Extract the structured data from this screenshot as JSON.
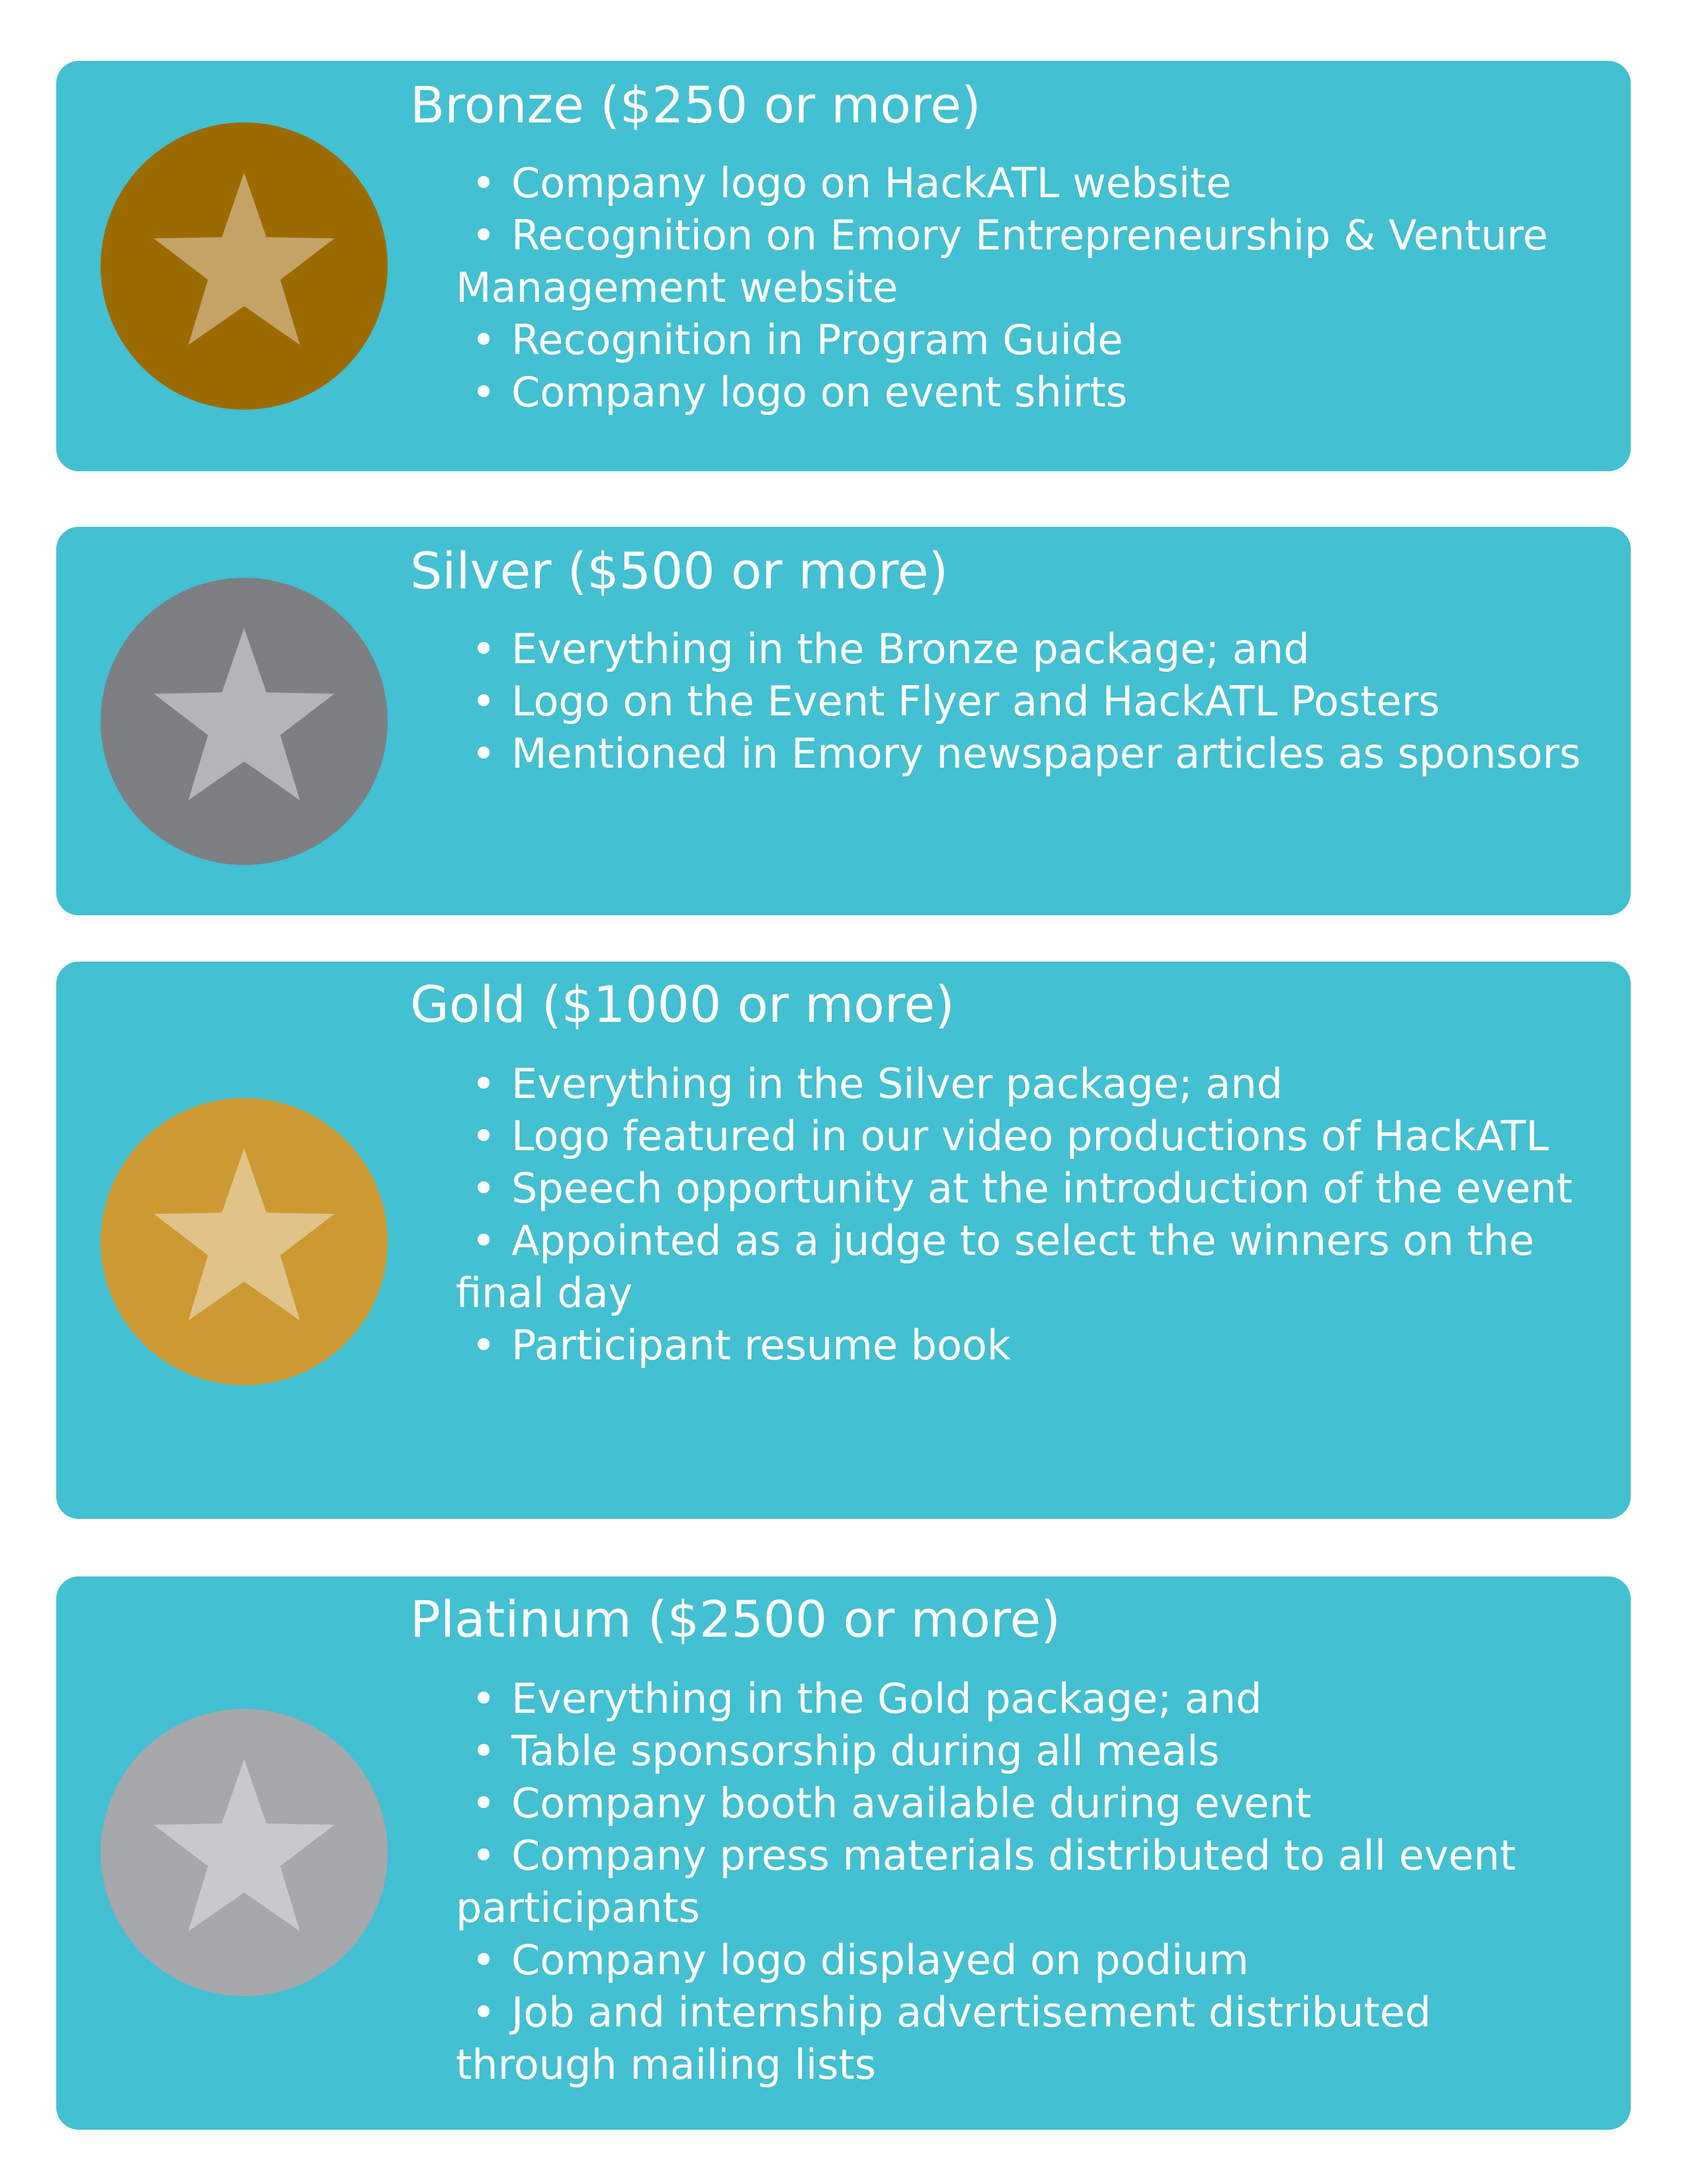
{
  "colors": {
    "card_background": "#43c0d1",
    "text": "#ffffff",
    "bronze_medal": "#9c6b00",
    "bronze_star": "#c4a466",
    "silver_medal": "#7d7f83",
    "silver_star": "#b4b5b8",
    "gold_medal": "#cc9932",
    "gold_star": "#e0c487",
    "platinum_medal": "#a6a8ab",
    "platinum_star": "#c9cacc"
  },
  "bullet_glyph": "•",
  "tiers": [
    {
      "icon": "bronze-star-medal-icon",
      "title": "Bronze ($250 or more)",
      "benefits": [
        "Company logo on HackATL website",
        "Recognition on Emory Entrepreneurship & Venture Management website",
        "Recognition in Program Guide",
        "Company logo on event shirts"
      ]
    },
    {
      "icon": "silver-star-medal-icon",
      "title": "Silver ($500 or more)",
      "benefits": [
        "Everything in the Bronze package; and",
        "Logo on the Event Flyer and HackATL Posters",
        "Mentioned in Emory newspaper articles as sponsors"
      ]
    },
    {
      "icon": "gold-star-medal-icon",
      "title": "Gold ($1000 or more)",
      "benefits": [
        "Everything in the Silver package; and",
        "Logo featured in our video productions of HackATL",
        "Speech opportunity at the introduction of the event",
        "Appointed as a judge to select the winners on the final day",
        "Participant resume book"
      ]
    },
    {
      "icon": "platinum-star-medal-icon",
      "title": "Platinum ($2500 or more)",
      "benefits": [
        "Everything in the Gold package; and",
        "Table sponsorship during all meals",
        "Company booth available during event",
        "Company press materials distributed to all event participants",
        "Company logo displayed on podium",
        "Job and internship advertisement distributed through mailing lists"
      ]
    }
  ]
}
